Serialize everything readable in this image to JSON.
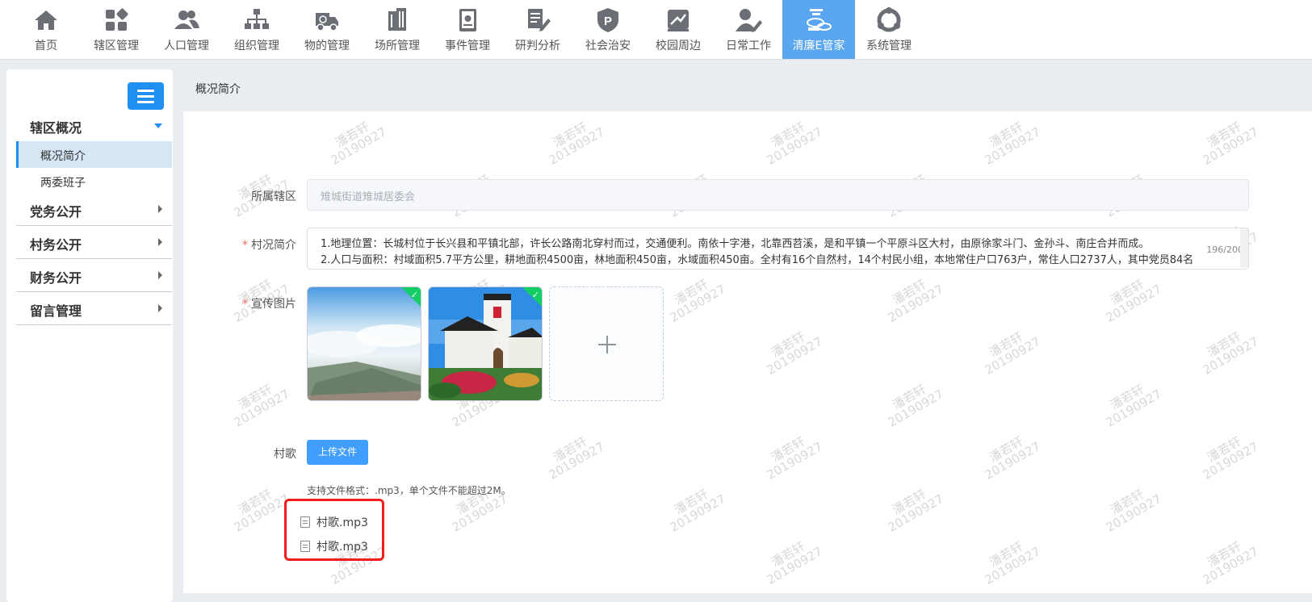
{
  "nav": {
    "items": [
      {
        "label": "首页",
        "icon": "home-icon"
      },
      {
        "label": "辖区管理",
        "icon": "grid-icon"
      },
      {
        "label": "人口管理",
        "icon": "people-icon"
      },
      {
        "label": "组织管理",
        "icon": "org-chart-icon"
      },
      {
        "label": "物的管理",
        "icon": "truck-icon"
      },
      {
        "label": "场所管理",
        "icon": "building-icon"
      },
      {
        "label": "事件管理",
        "icon": "book-icon"
      },
      {
        "label": "研判分析",
        "icon": "report-icon"
      },
      {
        "label": "社会治安",
        "icon": "police-badge-icon"
      },
      {
        "label": "校园周边",
        "icon": "map-icon"
      },
      {
        "label": "日常工作",
        "icon": "user-edit-icon"
      },
      {
        "label": "清廉E管家",
        "icon": "coins-icon",
        "active": true
      },
      {
        "label": "系统管理",
        "icon": "settings-icon"
      }
    ],
    "accent": "#5aa6f0"
  },
  "sidebar": {
    "groups": [
      {
        "label": "辖区概况",
        "expanded": true,
        "children": [
          {
            "label": "概况简介",
            "active": true
          },
          {
            "label": "两委班子"
          }
        ]
      },
      {
        "label": "党务公开"
      },
      {
        "label": "村务公开"
      },
      {
        "label": "财务公开"
      },
      {
        "label": "留言管理"
      }
    ]
  },
  "page": {
    "title": "概况简介"
  },
  "form": {
    "district": {
      "label": "所属辖区",
      "placeholder": "雉城街道雉城居委会"
    },
    "intro": {
      "label": "村况简介",
      "required": true,
      "lines": [
        "1.地理位置：长城村位于长兴县和平镇北部，许长公路南北穿村而过，交通便利。南依十字港，北靠西苕溪，是和平镇一个平原斗区大村，由原徐家斗门、金孙斗、南庄合并而成。",
        "2.人口与面积：村域面积5.7平方公里，耕地面积4500亩，林地面积450亩，水域面积450亩。全村有16个自然村，14个村民小组，本地常住户口763户，常住人口2737人，其中党员84名"
      ],
      "counter": "196/200"
    },
    "images": {
      "label": "宣传图片",
      "required": true
    },
    "song": {
      "label": "村歌",
      "upload_label": "上传文件",
      "hint": "支持文件格式：.mp3，单个文件不能超过2M。",
      "files": [
        "村歌.mp3",
        "村歌.mp3"
      ]
    }
  },
  "watermark": {
    "name": "潘若轩",
    "date": "20190927"
  }
}
